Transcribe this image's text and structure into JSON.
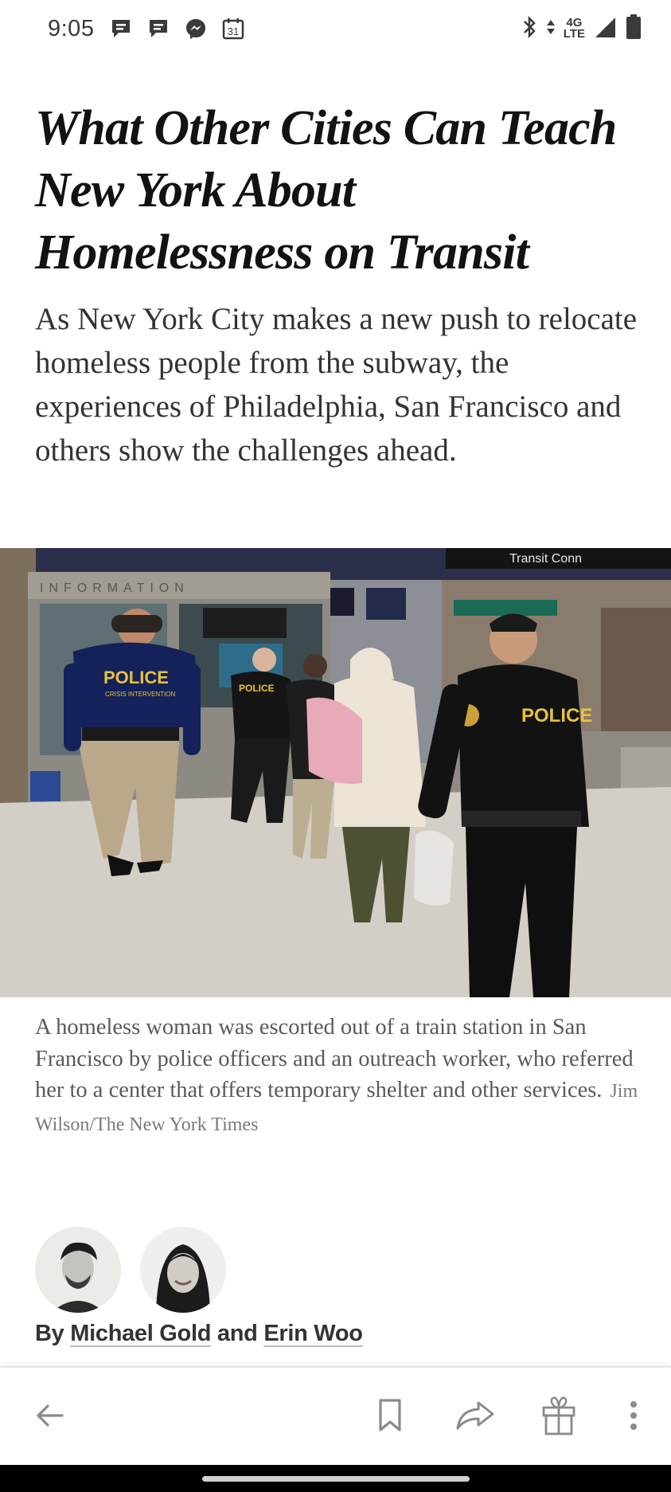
{
  "status_bar": {
    "time": "9:05",
    "notification_icons": [
      "message-icon",
      "message-icon",
      "messenger-icon",
      "calendar-icon"
    ],
    "calendar_day": "31",
    "network_top": "4G",
    "network_bottom": "LTE",
    "right_icons": [
      "bluetooth-icon",
      "data-arrows-icon",
      "signal-icon",
      "battery-icon"
    ]
  },
  "article": {
    "headline": "What Other Cities Can Teach New York About Homelessness on Transit",
    "summary": "As New York City makes a new push to relocate homeless people from the subway, the experiences of Philadelphia, San Francisco and others show the challenges ahead.",
    "photo": {
      "info_booth_text": "INFORMATION",
      "police_patch_left": "POLICE",
      "police_patch_left_sub": "CRISIS INTERVENTION",
      "police_patch_center": "POLICE",
      "police_patch_right": "POLICE",
      "sign_text": "Transit Conn"
    },
    "caption": "A homeless woman was escorted out of a train station in San Francisco by police officers and an outreach worker, who referred her to a center that offers temporary shelter and other services.",
    "credit": "Jim Wilson/The New York Times",
    "byline": {
      "prefix": "By",
      "author_1": "Michael Gold",
      "conjunction": "and",
      "author_2": "Erin Woo"
    }
  },
  "toolbar": {
    "items": [
      "back-arrow-icon",
      "bookmark-icon",
      "share-icon",
      "gift-icon",
      "more-vert-icon"
    ]
  },
  "colors": {
    "text_primary": "#121212",
    "text_secondary": "#333333",
    "caption": "#5a5a5a",
    "icon_gray": "#8a8a8a"
  }
}
